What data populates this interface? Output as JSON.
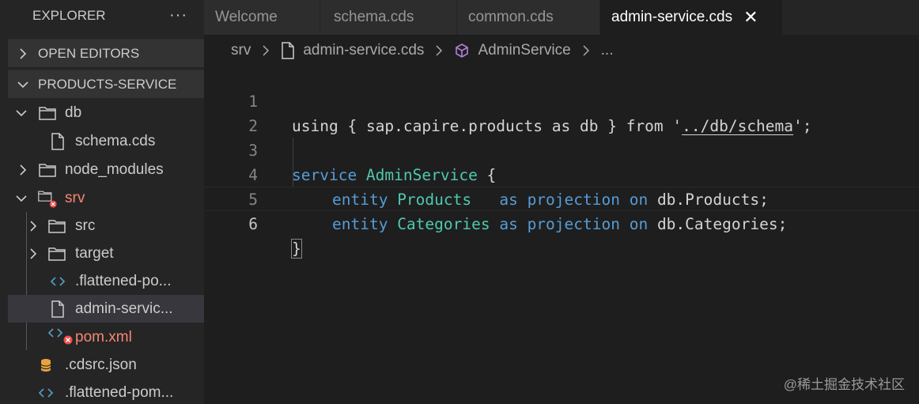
{
  "explorer": {
    "title": "EXPLORER",
    "more": "···",
    "open_editors": "OPEN EDITORS",
    "project": "PRODUCTS-SERVICE",
    "tree": [
      {
        "label": "db"
      },
      {
        "label": "schema.cds"
      },
      {
        "label": "node_modules"
      },
      {
        "label": "srv"
      },
      {
        "label": "src"
      },
      {
        "label": "target"
      },
      {
        "label": ".flattened-po..."
      },
      {
        "label": "admin-servic..."
      },
      {
        "label": "pom.xml"
      },
      {
        "label": ".cdsrc.json"
      },
      {
        "label": ".flattened-pom..."
      }
    ]
  },
  "tabs": [
    {
      "label": "Welcome"
    },
    {
      "label": "schema.cds"
    },
    {
      "label": "common.cds"
    },
    {
      "label": "admin-service.cds",
      "close": "✕"
    }
  ],
  "breadcrumb": {
    "folder": "srv",
    "file": "admin-service.cds",
    "symbol": "AdminService",
    "more": "..."
  },
  "editor": {
    "line_numbers": [
      "1",
      "2",
      "3",
      "4",
      "5",
      "6"
    ],
    "l1": {
      "kw": "using",
      "b1": " { ",
      "ns": "sap.capire.products",
      "as": " as ",
      "db": "db",
      "b2": " } ",
      "from": "from",
      "q1": " '",
      "path": "../db/schema",
      "q2": "'",
      "semi": ";"
    },
    "l3": {
      "kw": "service",
      "name": " AdminService",
      "brace": " {"
    },
    "l4": {
      "entity": "entity",
      "name": " Products",
      "as": "   as",
      "proj": " projection",
      "on": " on",
      "target": " db.Products;"
    },
    "l5": {
      "entity": "entity",
      "name": " Categories",
      "as": " as",
      "proj": " projection",
      "on": " on",
      "target": " db.Categories;"
    },
    "l6": {
      "brace": "}"
    }
  },
  "watermark": "@稀土掘金技术社区",
  "colors": {
    "keyword": "#569cd6",
    "type": "#4ec9b0",
    "string": "#ce9178",
    "error": "#f48771"
  }
}
